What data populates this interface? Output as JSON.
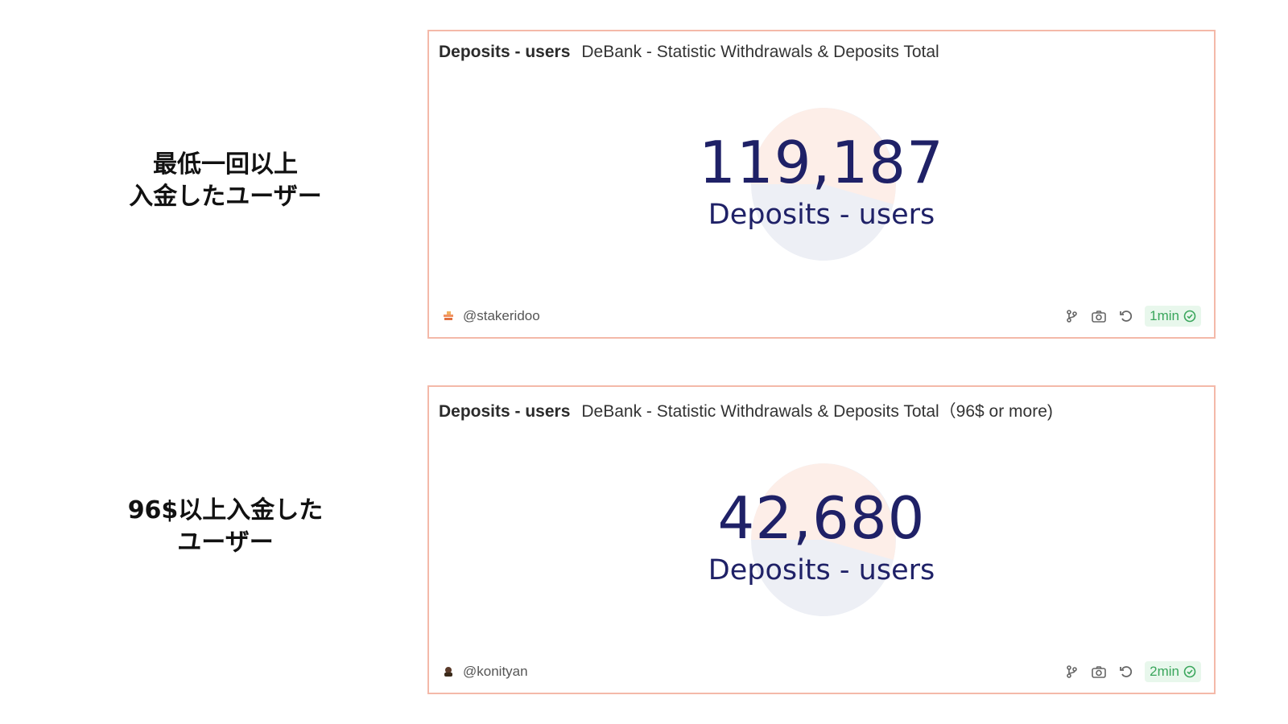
{
  "annotations": [
    {
      "lines": [
        "最低一回以上",
        "入金したユーザー"
      ]
    },
    {
      "lines": [
        "96$以上入金した",
        "ユーザー"
      ]
    }
  ],
  "cards": [
    {
      "query_title": "Deposits - users",
      "dashboard_title": "DeBank - Statistic Withdrawals & Deposits Total",
      "counter_value": "119,187",
      "counter_label": "Deposits - users",
      "author": "@stakeridoo",
      "refresh_badge": "1min",
      "icons": [
        "fork-icon",
        "camera-icon",
        "refresh-icon",
        "check-circle-icon"
      ]
    },
    {
      "query_title": "Deposits - users",
      "dashboard_title": "DeBank - Statistic Withdrawals & Deposits Total（96$ or more)",
      "counter_value": "42,680",
      "counter_label": "Deposits - users",
      "author": "@konityan",
      "refresh_badge": "2min",
      "icons": [
        "fork-icon",
        "camera-icon",
        "refresh-icon",
        "check-circle-icon"
      ]
    }
  ],
  "colors": {
    "card_border": "#f4b9a9",
    "counter_text": "#1f2167",
    "pie_peach": "#fdeee8",
    "pie_lavender": "#edeff5",
    "badge_green": "#3aa65c",
    "badge_bg": "#e8f7ec"
  }
}
